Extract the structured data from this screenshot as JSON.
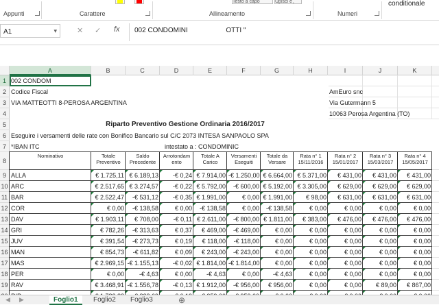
{
  "ribbon": {
    "groups": [
      "Appunti",
      "Carattere",
      "Allineamento",
      "Numeri"
    ],
    "wrap_text_btn": "Testo a capo",
    "merge_btn": "Unisci e allinea al centro",
    "cond_format_label": "conditionale",
    "fill_color": "#ffff00",
    "font_color": "#ff0000"
  },
  "formula_bar": {
    "name_box": "A1",
    "cancel_glyph": "✕",
    "enter_glyph": "✓",
    "fx_label": "fx",
    "content": "002 CONDOMINI                    OTTI \""
  },
  "columns": [
    "A",
    "B",
    "C",
    "D",
    "E",
    "F",
    "G",
    "H",
    "I",
    "J",
    "K"
  ],
  "row_numbers": [
    "1",
    "2",
    "3",
    "4",
    "5",
    "6",
    "7",
    "8",
    "9",
    "10",
    "11",
    "12",
    "13",
    "14",
    "15",
    "16",
    "17",
    "18",
    "19",
    "20"
  ],
  "texts": {
    "a1": "002 CONDOM",
    "a2": "Codice Fiscal",
    "a3": "VIA MATTEOTTI 8-PEROSA ARGENTINA",
    "i2": "AmEuro snc",
    "i3": "Via Gutermann 5",
    "i4": "10063 Perosa Argentina (TO)",
    "title": "Riparto Preventivo Gestione Ordinaria 2016/2017",
    "a6": "Eseguire i versamenti delle rate con Bonifico Bancario sul C/C 2073 INTESA SANPAOLO SPA",
    "a7": "*IBAN ITC",
    "e7": "intestato a : CONDOMINIC"
  },
  "headers": [
    "Nominativo",
    "Totale Preventivo",
    "Saldo Precedente",
    "Arrotondam ento",
    "Totale A Carico",
    "Versamenti Eseguiti",
    "Totale da Versare",
    "Rata n° 1 15/11/2016",
    "Rata n° 2 15/01/2017",
    "Rata n° 3 15/03/2017",
    "Rata n° 4 15/05/2017"
  ],
  "rows": [
    {
      "name": "ALLA",
      "v": [
        "€ 1.725,11",
        "€ 6.189,13",
        "-€ 0,24",
        "€ 7.914,00",
        "-€ 1.250,00",
        "€ 6.664,00",
        "€ 5.371,00",
        "€ 431,00",
        "€ 431,00",
        "€ 431,00"
      ]
    },
    {
      "name": "ARC",
      "v": [
        "€ 2.517,65",
        "€ 3.274,57",
        "-€ 0,22",
        "€ 5.792,00",
        "-€ 600,00",
        "€ 5.192,00",
        "€ 3.305,00",
        "€ 629,00",
        "€ 629,00",
        "€ 629,00"
      ]
    },
    {
      "name": "BAR",
      "v": [
        "€ 2.522,47",
        "-€ 531,12",
        "-€ 0,35",
        "€ 1.991,00",
        "€ 0,00",
        "€ 1.991,00",
        "€ 98,00",
        "€ 631,00",
        "€ 631,00",
        "€ 631,00"
      ]
    },
    {
      "name": "COR",
      "v": [
        "€ 0,00",
        "-€ 138,58",
        "€ 0,00",
        "-€ 138,58",
        "€ 0,00",
        "-€ 138,58",
        "€ 0,00",
        "€ 0,00",
        "€ 0,00",
        "€ 0,00"
      ]
    },
    {
      "name": "DAV",
      "v": [
        "€ 1.903,11",
        "€ 708,00",
        "-€ 0,11",
        "€ 2.611,00",
        "-€ 800,00",
        "€ 1.811,00",
        "€ 383,00",
        "€ 476,00",
        "€ 476,00",
        "€ 476,00"
      ]
    },
    {
      "name": "GRI",
      "v": [
        "€ 782,26",
        "-€ 313,63",
        "€ 0,37",
        "€ 469,00",
        "-€ 469,00",
        "€ 0,00",
        "€ 0,00",
        "€ 0,00",
        "€ 0,00",
        "€ 0,00"
      ]
    },
    {
      "name": "JUV",
      "v": [
        "€ 391,54",
        "-€ 273,73",
        "€ 0,19",
        "€ 118,00",
        "-€ 118,00",
        "€ 0,00",
        "€ 0,00",
        "€ 0,00",
        "€ 0,00",
        "€ 0,00"
      ]
    },
    {
      "name": "MAN",
      "v": [
        "€ 854,73",
        "-€ 611,82",
        "€ 0,09",
        "€ 243,00",
        "-€ 243,00",
        "€ 0,00",
        "€ 0,00",
        "€ 0,00",
        "€ 0,00",
        "€ 0,00"
      ]
    },
    {
      "name": "MAS",
      "v": [
        "€ 2.969,15",
        "-€ 1.155,13",
        "-€ 0,02",
        "€ 1.814,00",
        "-€ 1.814,00",
        "€ 0,00",
        "€ 0,00",
        "€ 0,00",
        "€ 0,00",
        "€ 0,00"
      ]
    },
    {
      "name": "PER",
      "v": [
        "€ 0,00",
        "-€ 4,63",
        "€ 0,00",
        "-€ 4,63",
        "€ 0,00",
        "-€ 4,63",
        "€ 0,00",
        "€ 0,00",
        "€ 0,00",
        "€ 0,00"
      ]
    },
    {
      "name": "RAV",
      "v": [
        "€ 3.468,91",
        "-€ 1.556,78",
        "-€ 0,13",
        "€ 1.912,00",
        "-€ 956,00",
        "€ 956,00",
        "€ 0,00",
        "€ 0,00",
        "€ 89,00",
        "€ 867,00"
      ]
    },
    {
      "name": "RIP",
      "v": [
        "€ 1.782,88",
        "-€ 823,69",
        "-€ 0,19",
        "€ 959,00",
        "-€ 959,00",
        "€ 0,00",
        "€ 0,00",
        "€ 0,00",
        "€ 0,00",
        "€ 0,00"
      ]
    }
  ],
  "sheets": [
    "Foglio1",
    "Foglio2",
    "Foglio3"
  ],
  "add_sheet": "⊕",
  "nav_prev": "◀",
  "nav_next": "▶"
}
